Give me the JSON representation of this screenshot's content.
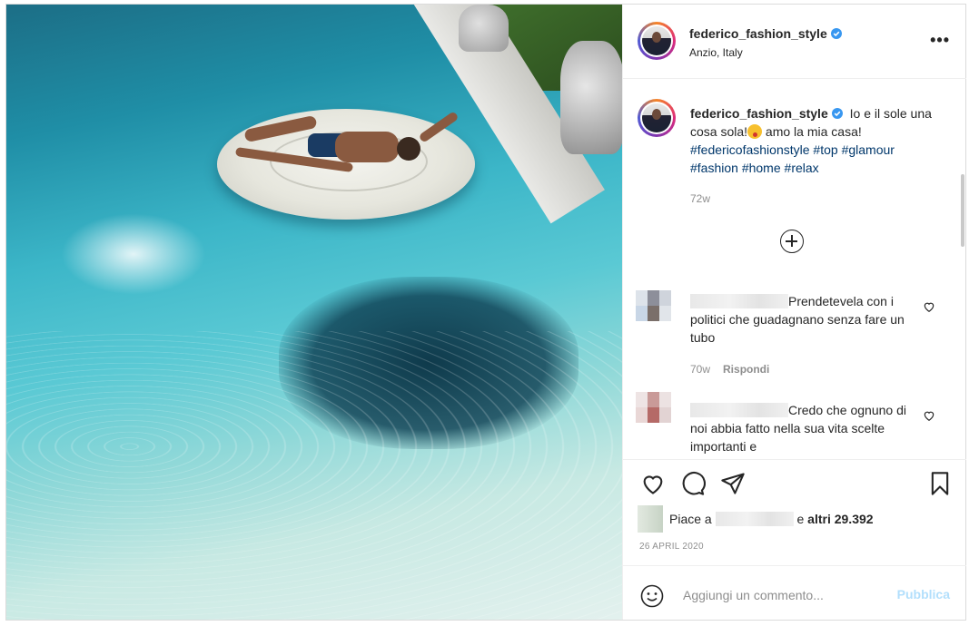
{
  "post": {
    "username": "federico_fashion_style",
    "location": "Anzio, Italy",
    "caption": {
      "text_part1": "Io e il sole una cosa sola!",
      "text_part2": " amo la mia casa!",
      "hashtags": [
        "#federicofashionstyle",
        "#top",
        "#glamour",
        "#fashion",
        "#home",
        "#relax"
      ],
      "time": "72w"
    },
    "comments": [
      {
        "text": "Prendetevela con i politici che guadagnano senza fare un tubo",
        "time": "70w",
        "reply_label": "Rispondi"
      },
      {
        "text": "Credo che ognuno di noi abbia fatto nella sua vita scelte importanti e",
        "time": "",
        "reply_label": ""
      }
    ],
    "likes": {
      "prefix": "Piace a",
      "connector": "e",
      "count_text": "altri 29.392"
    },
    "date": "26 APRIL 2020",
    "add_comment": {
      "placeholder": "Aggiungi un commento...",
      "publish_label": "Pubblica"
    }
  },
  "colors": {
    "link": "#00376b",
    "publish_disabled": "#b2dffc",
    "verified": "#3897f0",
    "muted": "#8e8e8e"
  },
  "icons": [
    "more-options-icon",
    "verified-badge-icon",
    "emoji-tongue-icon",
    "load-more-plus-icon",
    "heart-icon",
    "comment-icon",
    "share-icon",
    "bookmark-icon",
    "smiley-icon"
  ]
}
